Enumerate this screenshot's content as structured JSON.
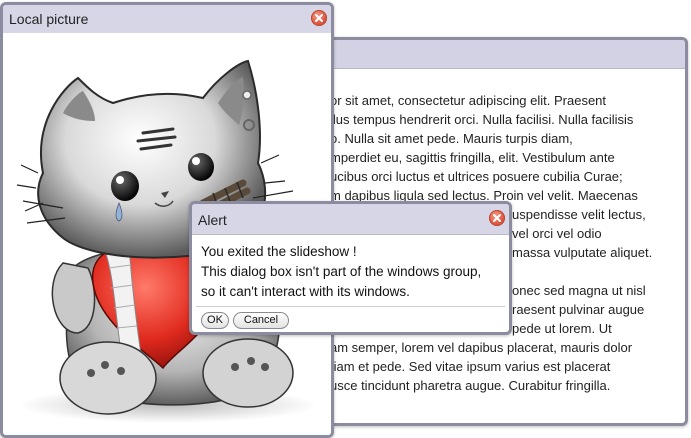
{
  "text_window": {
    "title": "",
    "paragraph1": [
      "or sit amet, consectetur adipiscing elit. Praesent",
      "llus tempus hendrerit orci. Nulla facilisi. Nulla facilisis",
      "o. Nulla sit amet pede. Mauris turpis diam,",
      "mperdiet eu, sagittis fringilla, elit. Vestibulum ante",
      "ucibus orci luctus et ultrices posuere cubilia Curae;",
      "m dapibus ligula sed lectus. Proin vel velit. Maecenas",
      "uspendisse velit lectus,",
      "vel orci vel odio",
      "massa vulputate aliquet."
    ],
    "paragraph2": [
      "onec sed magna ut nisl",
      "raesent pulvinar augue",
      "pede ut lorem. Ut",
      "am semper, lorem vel dapibus placerat, mauris dolor",
      "tiam et pede. Sed vitae ipsum varius est placerat",
      "usce tincidunt pharetra augue. Curabitur fringilla."
    ]
  },
  "picture_window": {
    "title": "Local picture",
    "image": "cartoon-kitten-holding-heart"
  },
  "alert": {
    "title": "Alert",
    "message": [
      "You exited the slideshow !",
      "This dialog box isn't part of the windows group,",
      "so it can't interact with its windows."
    ],
    "ok_label": "OK",
    "cancel_label": "Cancel"
  },
  "icons": {
    "close": "close-icon"
  },
  "colors": {
    "titlebar": "#d6d6e6",
    "frame": "#8c8ca0",
    "close": "#e15a43"
  }
}
